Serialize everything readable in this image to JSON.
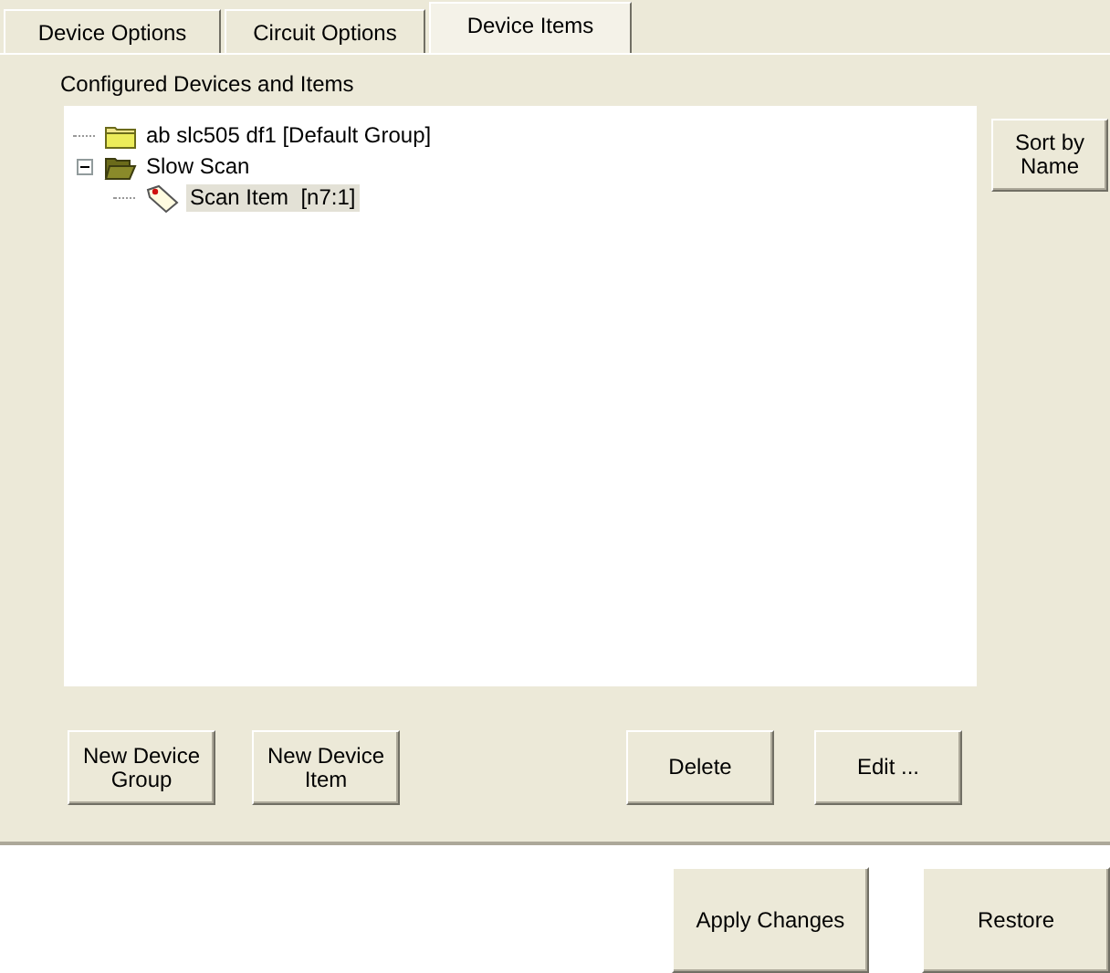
{
  "tabs": [
    {
      "label": "Device Options",
      "selected": false
    },
    {
      "label": "Circuit Options",
      "selected": false
    },
    {
      "label": "Device Items",
      "selected": true
    }
  ],
  "tree_label": "Configured Devices and Items",
  "tree": [
    {
      "kind": "folder",
      "label": "ab slc505 df1 [Default Group]",
      "expanded": false,
      "selected": false
    },
    {
      "kind": "folder",
      "label": "Slow Scan",
      "expanded": true,
      "selected": false,
      "children": [
        {
          "kind": "item",
          "label": "Scan Item  [n7:1]",
          "selected": true
        }
      ]
    }
  ],
  "side_button": "Sort by Name",
  "panel_buttons": [
    "New Device Group",
    "New Device Item",
    "Delete",
    "Edit ..."
  ],
  "footer_buttons": [
    "Apply Changes",
    "Restore"
  ]
}
